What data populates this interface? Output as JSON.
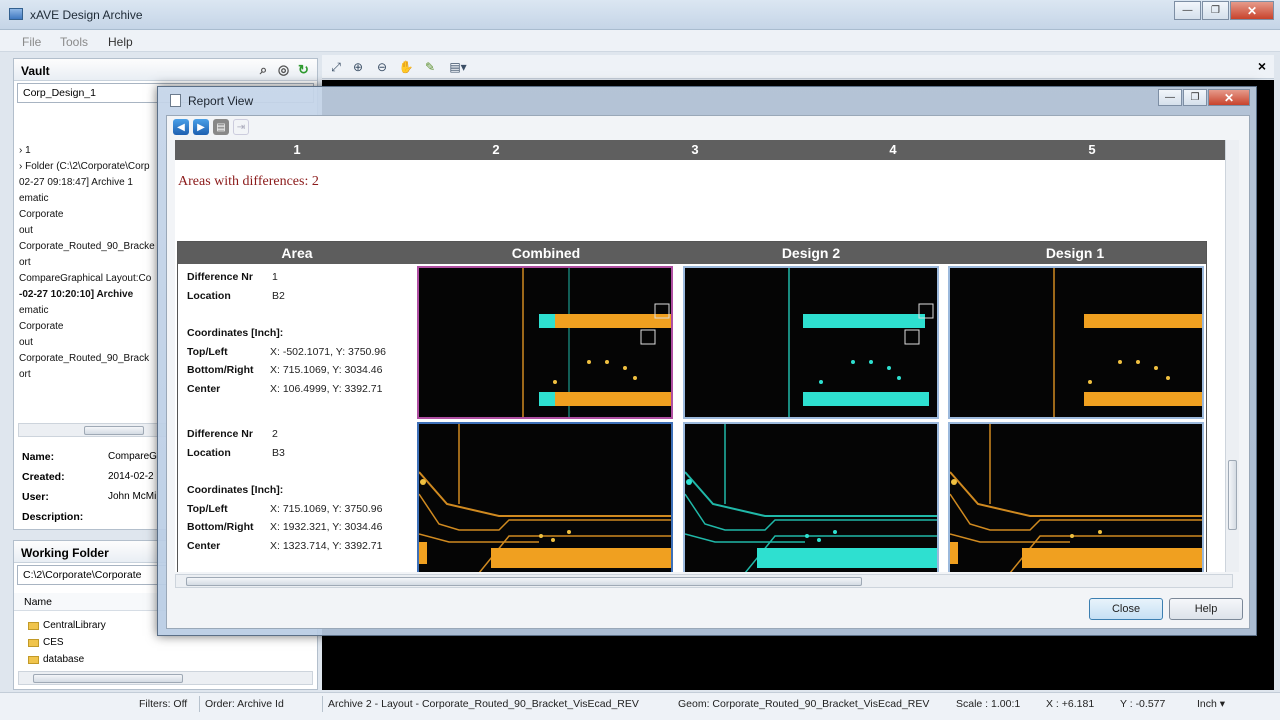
{
  "app": {
    "title": "xAVE Design Archive"
  },
  "menu": {
    "items": [
      "File",
      "Tools",
      "Help"
    ]
  },
  "vault": {
    "title": "Vault",
    "selected": "Corp_Design_1",
    "tree": [
      "› 1",
      "› Folder (C:\\2\\Corporate\\Corp",
      "02-27 09:18:47] Archive 1",
      "ematic",
      "Corporate",
      "out",
      "Corporate_Routed_90_Bracke",
      "ort",
      "CompareGraphical Layout:Co",
      "-02-27 10:20:10] Archive",
      "ematic",
      "Corporate",
      "out",
      "Corporate_Routed_90_Brack",
      "ort"
    ],
    "props": {
      "name_label": "Name:",
      "name_value": "CompareG",
      "created_label": "Created:",
      "created_value": "2014-02-2",
      "user_label": "User:",
      "user_value": "John McMi",
      "description_label": "Description:"
    }
  },
  "working_folder": {
    "title": "Working Folder",
    "path": "C:\\2\\Corporate\\Corporate",
    "column": "Name",
    "folders": [
      "CentralLibrary",
      "CES",
      "database"
    ]
  },
  "toolbar": {
    "icons": [
      "zoom-fit-icon",
      "zoom-in-icon",
      "zoom-out-icon",
      "pan-icon",
      "highlight-icon",
      "report-icon"
    ],
    "close": "×"
  },
  "status": {
    "filters": "Filters: Off",
    "order": "Order: Archive Id",
    "archive": "Archive 2 - Layout - Corporate_Routed_90_Bracket_VisEcad_REV",
    "geom": "Geom: Corporate_Routed_90_Bracket_VisEcad_REV",
    "scale": "Scale : 1.00:1",
    "x": "X : +6.181",
    "y": "Y : -0.577",
    "unit": "Inch ▾"
  },
  "dialog": {
    "title": "Report View",
    "ruler": [
      "1",
      "2",
      "3",
      "4",
      "5"
    ],
    "areas_title": "Areas with differences: 2",
    "columns": [
      "Area",
      "Combined",
      "Design 2",
      "Design 1"
    ],
    "rows": [
      {
        "diff_label": "Difference Nr",
        "diff": "1",
        "loc_label": "Location",
        "loc": "B2",
        "coords_label": "Coordinates [Inch]:",
        "tl_label": "Top/Left",
        "tl": "X: -502.1071, Y: 3750.96",
        "br_label": "Bottom/Right",
        "br": "X: 715.1069, Y: 3034.46",
        "c_label": "Center",
        "c": "X: 106.4999, Y: 3392.71"
      },
      {
        "diff_label": "Difference Nr",
        "diff": "2",
        "loc_label": "Location",
        "loc": "B3",
        "coords_label": "Coordinates [Inch]:",
        "tl_label": "Top/Left",
        "tl": "X: 715.1069, Y: 3750.96",
        "br_label": "Bottom/Right",
        "br": "X: 1932.321, Y: 3034.46",
        "c_label": "Center",
        "c": "X: 1323.714, Y: 3392.71"
      }
    ],
    "buttons": {
      "close": "Close",
      "help": "Help"
    }
  }
}
